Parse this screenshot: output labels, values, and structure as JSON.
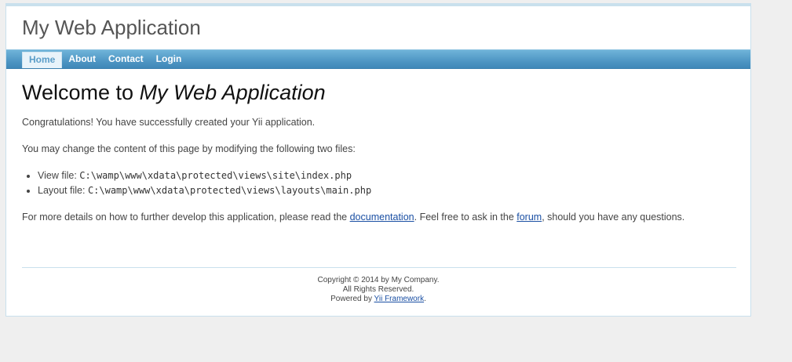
{
  "header": {
    "title": "My Web Application"
  },
  "menu": {
    "items": [
      {
        "label": "Home",
        "active": true
      },
      {
        "label": "About",
        "active": false
      },
      {
        "label": "Contact",
        "active": false
      },
      {
        "label": "Login",
        "active": false
      }
    ]
  },
  "content": {
    "heading_prefix": "Welcome to ",
    "heading_app": "My Web Application",
    "congrats": "Congratulations! You have successfully created your Yii application.",
    "change_intro": "You may change the content of this page by modifying the following two files:",
    "files": [
      {
        "label": "View file: ",
        "path": "C:\\wamp\\www\\xdata\\protected\\views\\site\\index.php"
      },
      {
        "label": "Layout file: ",
        "path": "C:\\wamp\\www\\xdata\\protected\\views\\layouts\\main.php"
      }
    ],
    "details_before": "For more details on how to further develop this application, please read the ",
    "documentation_link": "documentation",
    "details_middle": ". Feel free to ask in the ",
    "forum_link": "forum",
    "details_after": ", should you have any questions."
  },
  "footer": {
    "copyright": "Copyright © 2014 by My Company.",
    "rights": "All Rights Reserved.",
    "powered_prefix": "Powered by ",
    "framework_link": "Yii Framework",
    "powered_suffix": "."
  },
  "colors": {
    "menu_bar": "#4f96c4",
    "link": "#1a4fa3",
    "border": "#c9e0ed",
    "background": "#efefef"
  }
}
